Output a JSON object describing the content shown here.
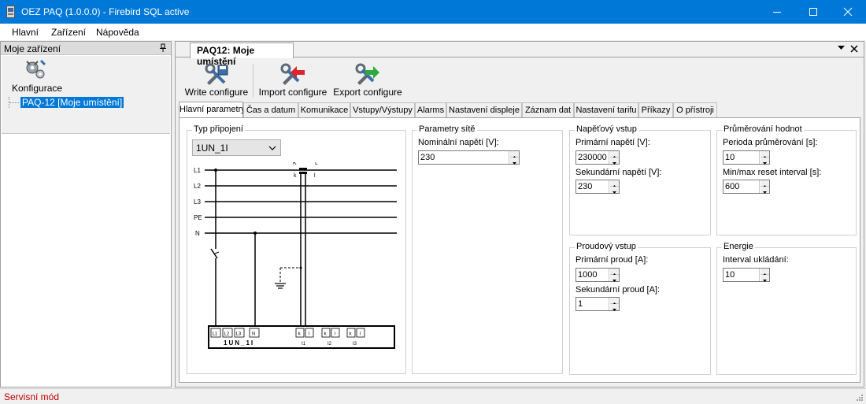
{
  "window": {
    "title": "OEZ PAQ (1.0.0.0) - Firebird SQL active"
  },
  "menu": [
    "Hlavní",
    "Zařízení",
    "Nápověda"
  ],
  "left_panel": {
    "title": "Moje zařízení",
    "tool_label": "Konfigurace",
    "tree_item": "PAQ-12 [Moje umístění]"
  },
  "document": {
    "tab_title": "PAQ12: Moje umístění",
    "toolbar": {
      "write": "Write configure",
      "import": "Import configure",
      "export": "Export configure"
    },
    "tabs": [
      "Hlavní parametry",
      "Čas a datum",
      "Komunikace",
      "Vstupy/Výstupy",
      "Alarms",
      "Nastavení displeje",
      "Záznam dat",
      "Nastavení tarifu",
      "Příkazy",
      "O přístroji"
    ],
    "active_tab": 0,
    "connection": {
      "title": "Typ připojení",
      "selected": "1UN_1I",
      "lines": [
        "L1",
        "L2",
        "L3",
        "PE",
        "N"
      ],
      "ct_primary": "K",
      "ct_secondary": "L",
      "ct_k": "k",
      "ct_l": "l",
      "terminals": [
        "L1",
        "L2",
        "L3",
        "N",
        "k",
        "l",
        "k",
        "l",
        "k",
        "l"
      ],
      "device_label": "1UN_1I",
      "current_labels": [
        "I1",
        "I2",
        "I3"
      ]
    },
    "network_params": {
      "title": "Parametry sítě",
      "nominal_voltage_label": "Nominální napětí [V]:",
      "nominal_voltage": "230"
    },
    "voltage_input": {
      "title": "Napěťový vstup",
      "primary_label": "Primární napětí [V]:",
      "primary": "230000",
      "secondary_label": "Sekundární napětí [V]:",
      "secondary": "230"
    },
    "averaging": {
      "title": "Průměrování hodnot",
      "period_label": "Perioda průměrování [s]:",
      "period": "10",
      "reset_label": "Min/max reset interval [s]:",
      "reset": "600"
    },
    "current_input": {
      "title": "Proudový vstup",
      "primary_label": "Primární proud [A]:",
      "primary": "1000",
      "secondary_label": "Sekundární proud [A]:",
      "secondary": "1"
    },
    "energy": {
      "title": "Energie",
      "interval_label": "Interval ukládání:",
      "interval": "10"
    }
  },
  "status": "Servisní mód",
  "colors": {
    "titlebar": "#0078d7",
    "status_text": "#c00000",
    "selection": "#0078d7"
  }
}
